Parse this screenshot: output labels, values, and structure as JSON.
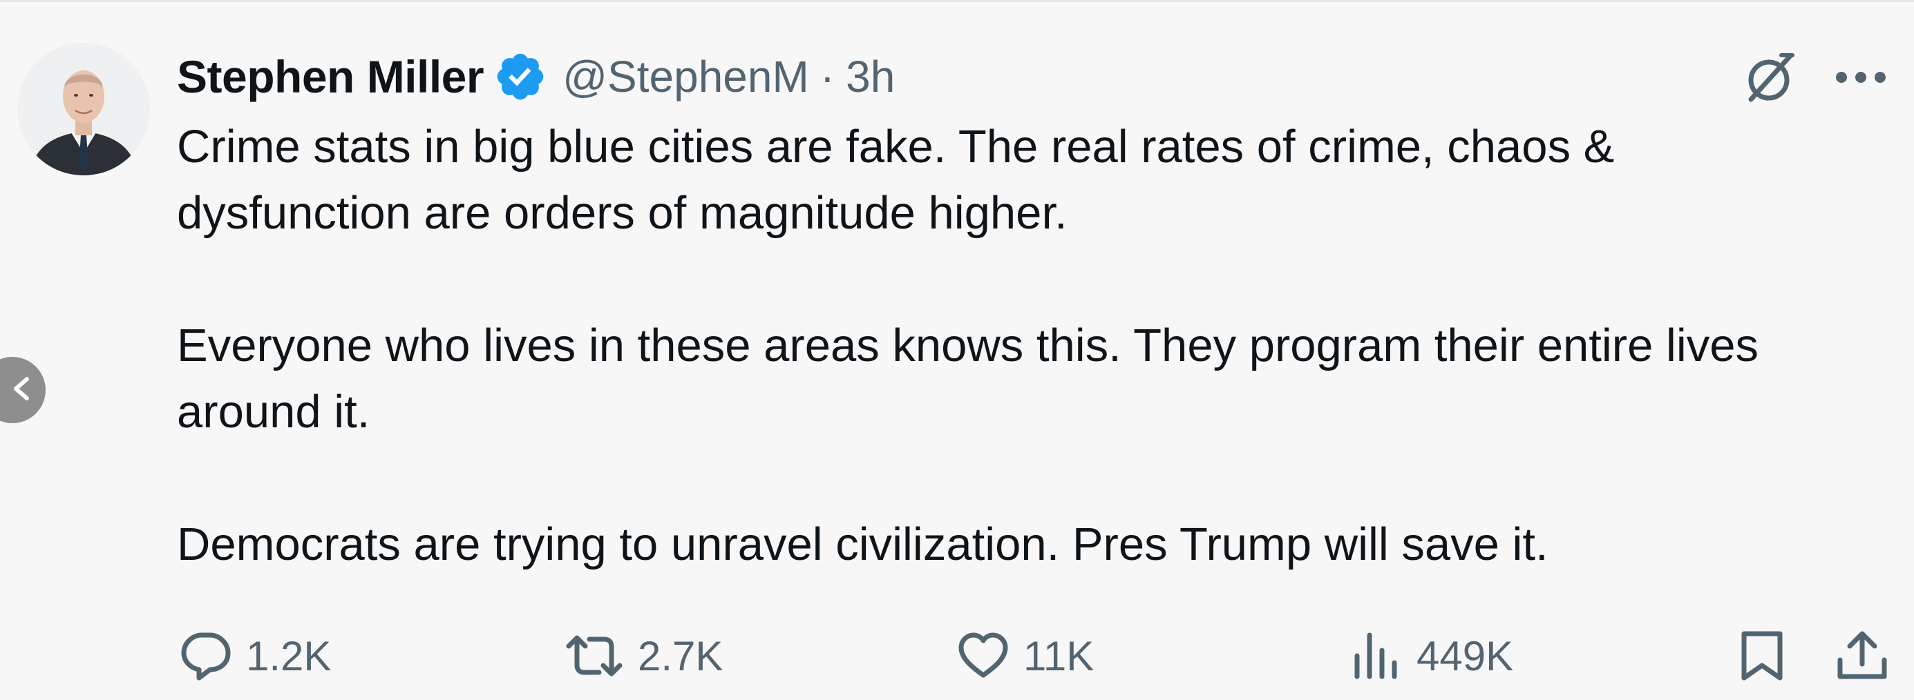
{
  "author": {
    "display_name": "Stephen Miller",
    "handle": "@StephenM",
    "separator": "·",
    "time": "3h",
    "verified": true,
    "verified_color": "#1d9bf0"
  },
  "tweet": {
    "paragraphs": [
      "Crime stats in big blue cities are fake. The real rates of crime, chaos & dysfunction are orders of magnitude higher.",
      "Everyone who lives in these areas knows this. They program their entire lives around it.",
      "Democrats are trying to unravel civilization. Pres Trump will save it."
    ]
  },
  "actions": {
    "replies": "1.2K",
    "reposts": "2.7K",
    "likes": "11K",
    "views": "449K"
  },
  "icons": {
    "reply": "reply-icon",
    "repost": "repost-icon",
    "like": "heart-icon",
    "views": "views-icon",
    "bookmark": "bookmark-icon",
    "share": "share-icon",
    "grok": "grok-icon",
    "more": "more-icon",
    "back": "chevron-left-icon"
  },
  "colors": {
    "text": "#0f1419",
    "muted": "#536471",
    "background": "#f7f7f7"
  }
}
